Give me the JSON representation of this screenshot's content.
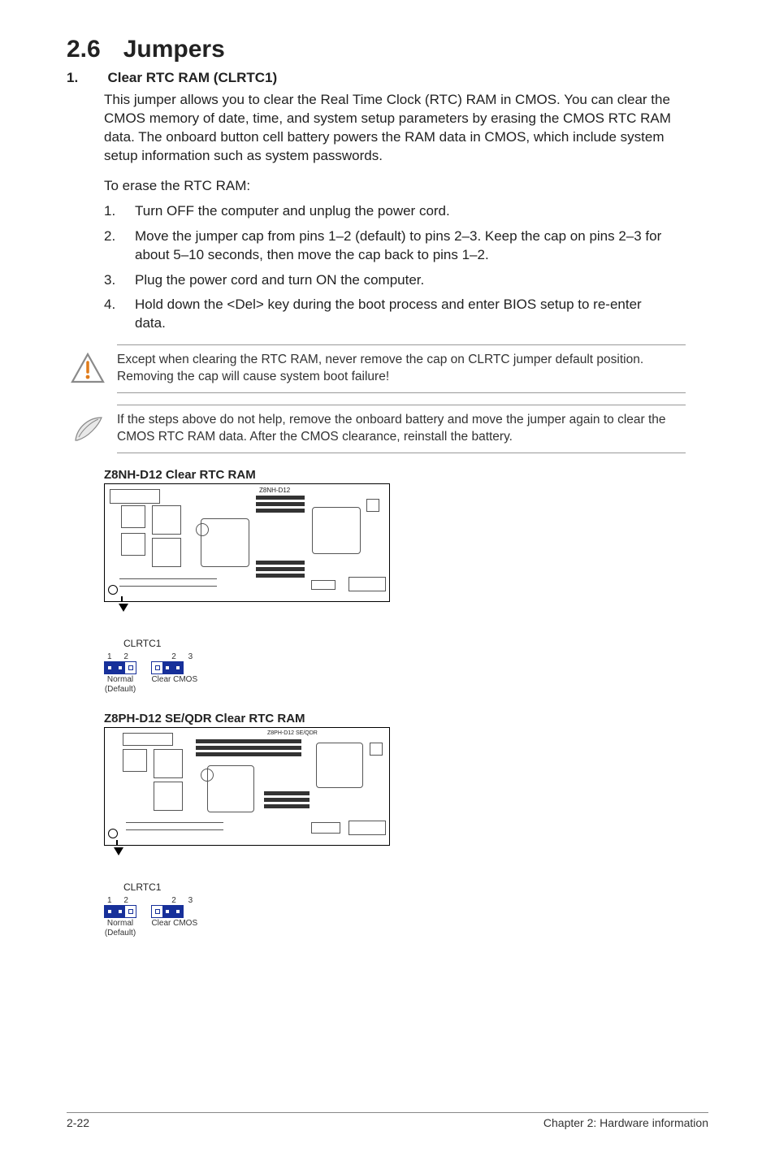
{
  "section": {
    "number": "2.6",
    "title": "Jumpers"
  },
  "item": {
    "number": "1.",
    "title": "Clear RTC RAM (CLRTC1)"
  },
  "para1": "This jumper allows you to clear the  Real Time Clock (RTC) RAM in CMOS. You can clear the CMOS memory of date, time, and system setup parameters by erasing the CMOS RTC RAM data. The onboard button cell battery powers the RAM data in CMOS, which include system setup information such as system passwords.",
  "para2": "To erase the RTC RAM:",
  "steps": [
    {
      "n": "1.",
      "t": "Turn OFF the computer and unplug the power cord."
    },
    {
      "n": "2.",
      "t": "Move the jumper cap from pins 1–2 (default) to pins 2–3. Keep the cap on pins 2–3 for about 5–10 seconds, then move the cap back to pins 1–2."
    },
    {
      "n": "3.",
      "t": "Plug the power cord and turn ON the computer."
    },
    {
      "n": "4.",
      "t": "Hold down the <Del> key during the boot process and enter BIOS setup to re-enter data."
    }
  ],
  "warn": "Except when clearing the RTC RAM, never remove the cap on CLRTC jumper default position. Removing the cap will cause system boot failure!",
  "note": "If the steps above do not help, remove the onboard battery and move the jumper again to clear the CMOS RTC RAM data. After the CMOS clearance, reinstall the battery.",
  "diagA": {
    "title": "Z8NH-D12 Clear RTC RAM",
    "board_label": "Z8NH-D12",
    "jumper_label": "CLRTC1",
    "left": {
      "pins_label": "1 2",
      "state_label": "Normal",
      "sub": "(Default)"
    },
    "right": {
      "pins_label": "2 3",
      "state_label": "Clear CMOS",
      "sub": ""
    }
  },
  "diagB": {
    "title": "Z8PH-D12 SE/QDR Clear RTC RAM",
    "board_label": "Z8PH-D12 SE/QDR",
    "jumper_label": "CLRTC1",
    "left": {
      "pins_label": "1 2",
      "state_label": "Normal",
      "sub": "(Default)"
    },
    "right": {
      "pins_label": "2 3",
      "state_label": "Clear CMOS",
      "sub": ""
    }
  },
  "footer": {
    "left": "2-22",
    "right": "Chapter 2: Hardware information"
  }
}
